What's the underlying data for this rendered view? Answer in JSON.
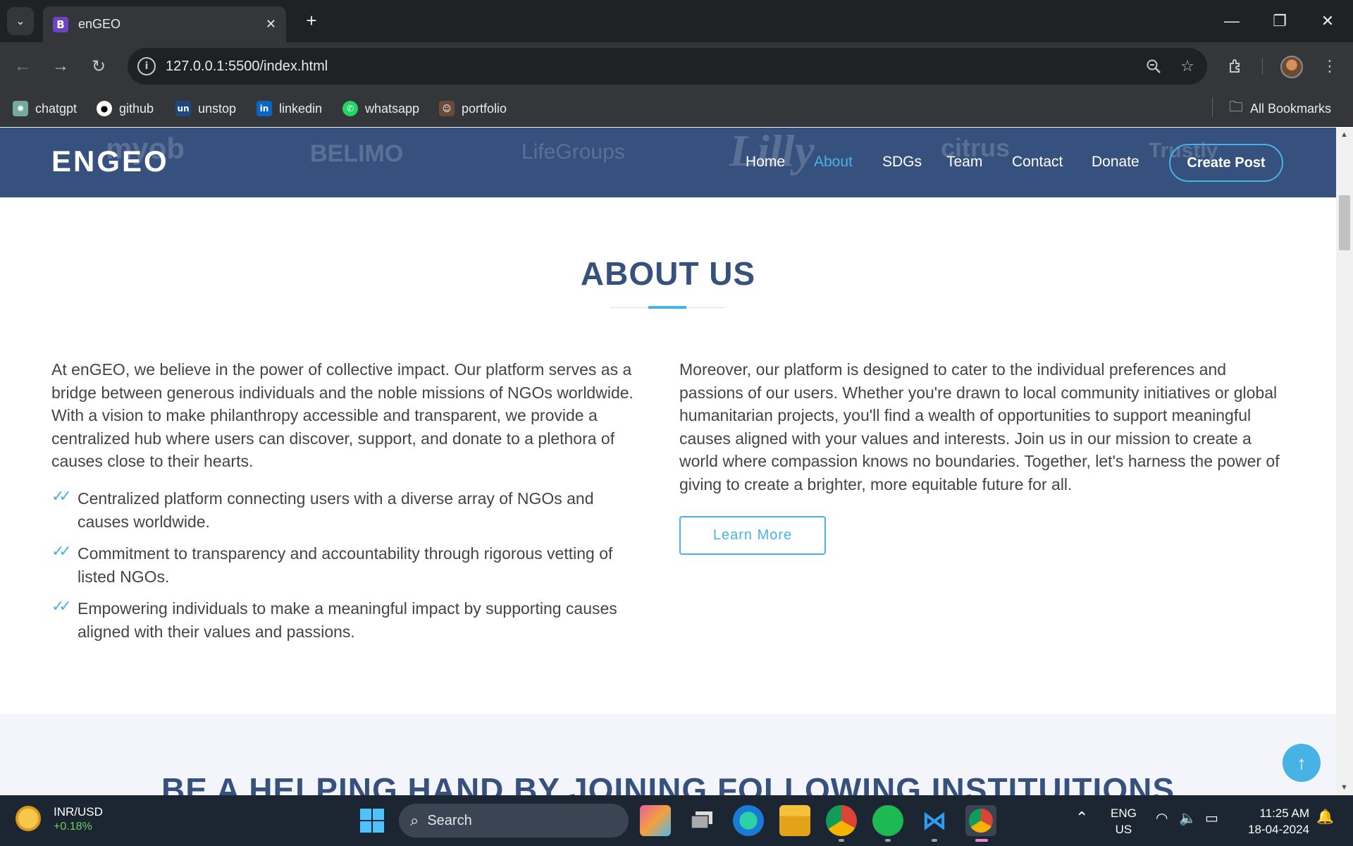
{
  "browser": {
    "tab_title": "enGEO",
    "tab_favicon": "B",
    "url": "127.0.0.1:5500/index.html",
    "bookmarks": [
      {
        "label": "chatgpt",
        "icon": "chatgpt-icon"
      },
      {
        "label": "github",
        "icon": "github-icon"
      },
      {
        "label": "unstop",
        "icon": "unstop-icon"
      },
      {
        "label": "linkedin",
        "icon": "linkedin-icon"
      },
      {
        "label": "whatsapp",
        "icon": "whatsapp-icon"
      },
      {
        "label": "portfolio",
        "icon": "portfolio-icon"
      }
    ],
    "all_bookmarks": "All Bookmarks"
  },
  "site": {
    "logo": "ENGEO",
    "bg_logos": [
      "myob",
      "BELIMO",
      "LifeGroups",
      "Lilly",
      "citrus",
      "Trustly"
    ],
    "nav": [
      {
        "label": "Home",
        "active": false
      },
      {
        "label": "About",
        "active": true
      },
      {
        "label": "SDGs",
        "active": false
      },
      {
        "label": "Team",
        "active": false
      },
      {
        "label": "Contact",
        "active": false
      },
      {
        "label": "Donate",
        "active": false
      }
    ],
    "cta": "Create Post",
    "colors": {
      "header": "#37517e",
      "accent": "#47b2e4"
    }
  },
  "about": {
    "title": "ABOUT US",
    "intro": "At enGEO, we believe in the power of collective impact. Our platform serves as a bridge between generous individuals and the noble missions of NGOs worldwide. With a vision to make philanthropy accessible and transparent, we provide a centralized hub where users can discover, support, and donate to a plethora of causes close to their hearts.",
    "points": [
      "Centralized platform connecting users with a diverse array of NGOs and causes worldwide.",
      "Commitment to transparency and accountability through rigorous vetting of listed NGOs.",
      "Empowering individuals to make a meaningful impact by supporting causes aligned with their values and passions."
    ],
    "right_text": "Moreover, our platform is designed to cater to the individual preferences and passions of our users. Whether you're drawn to local community initiatives or global humanitarian projects, you'll find a wealth of opportunities to support meaningful causes aligned with your values and interests. Join us in our mission to create a world where compassion knows no boundaries. Together, let's harness the power of giving to create a brighter, more equitable future for all.",
    "learn_more": "Learn More"
  },
  "section2": {
    "title": "BE A HELPING HAND BY JOINING FOLLOWING INSTITUITIONS"
  },
  "taskbar": {
    "widget_title": "INR/USD",
    "widget_change": "+0.18%",
    "search": "Search",
    "lang": "ENG",
    "region": "US",
    "time": "11:25 AM",
    "date": "18-04-2024"
  }
}
